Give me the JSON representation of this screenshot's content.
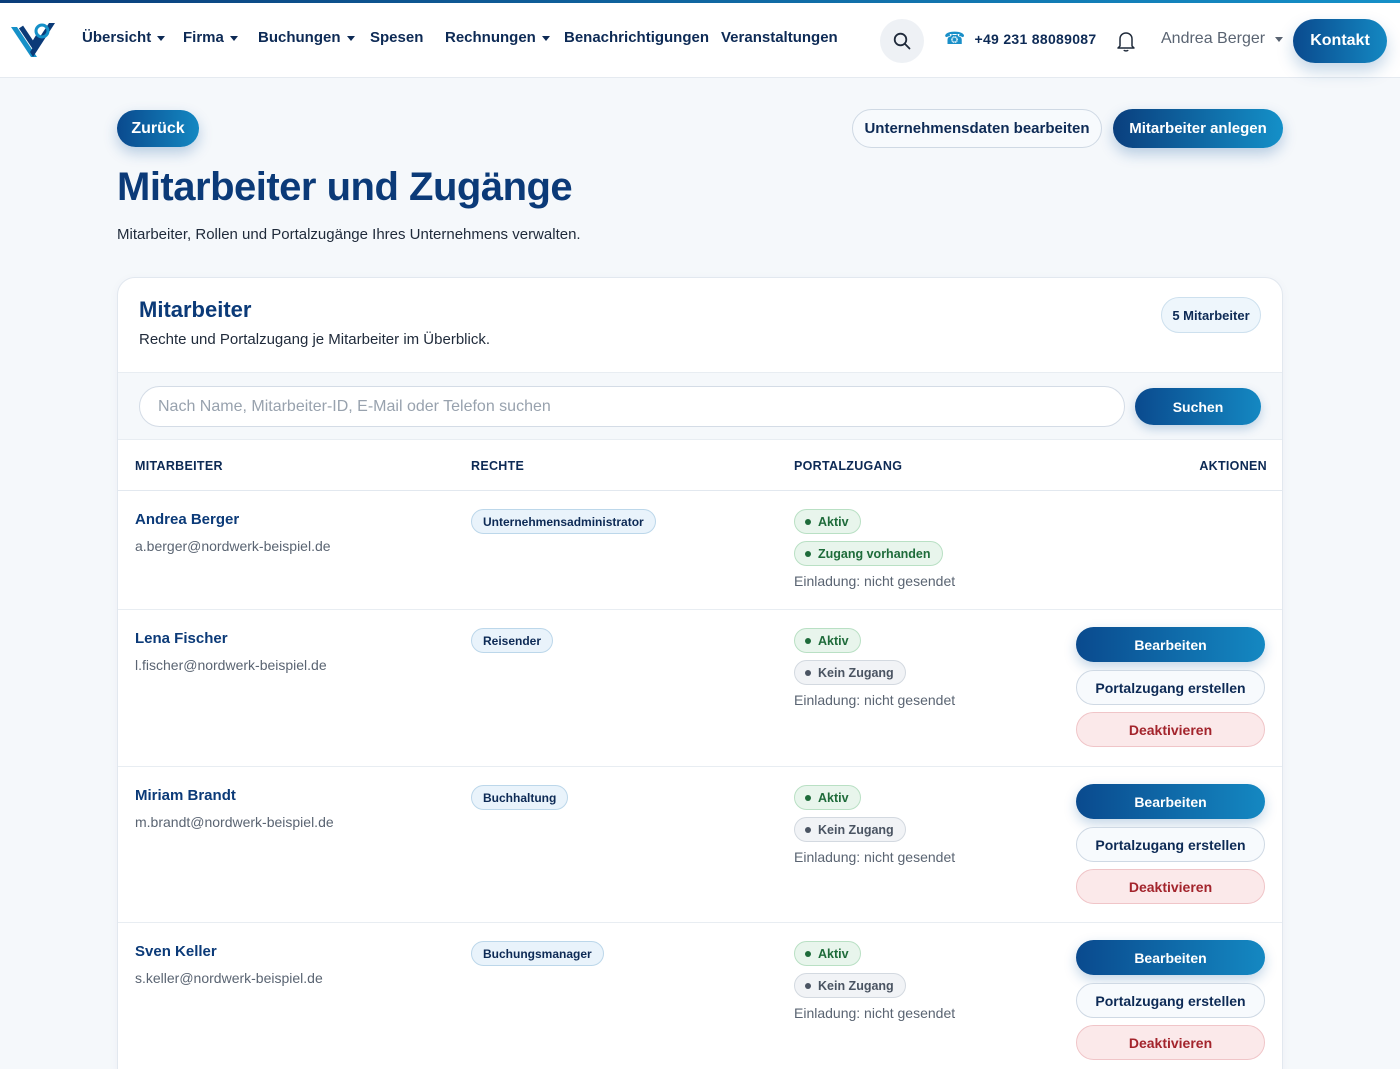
{
  "nav": {
    "items": [
      {
        "label": "Übersicht",
        "dropdown": true
      },
      {
        "label": "Firma",
        "dropdown": true
      },
      {
        "label": "Buchungen",
        "dropdown": true
      },
      {
        "label": "Spesen",
        "dropdown": false
      },
      {
        "label": "Rechnungen",
        "dropdown": true
      },
      {
        "label": "Benachrichtigungen",
        "dropdown": false
      },
      {
        "label": "Veranstaltungen",
        "dropdown": false
      }
    ],
    "phone": "+49 231 88089087",
    "user": "Andrea Berger",
    "contact_label": "Kontakt"
  },
  "page": {
    "back_label": "Zurück",
    "edit_company_label": "Unternehmensdaten bearbeiten",
    "add_employee_label": "Mitarbeiter anlegen",
    "title": "Mitarbeiter und Zugänge",
    "subtitle": "Mitarbeiter, Rollen und Portalzugänge Ihres Unternehmens verwalten."
  },
  "card": {
    "title": "Mitarbeiter",
    "subtitle": "Rechte und Portalzugang je Mitarbeiter im Überblick.",
    "count_badge": "5 Mitarbeiter",
    "search_placeholder": "Nach Name, Mitarbeiter-ID, E-Mail oder Telefon suchen",
    "search_value": "",
    "search_button": "Suchen"
  },
  "table": {
    "headers": [
      "MITARBEITER",
      "RECHTE",
      "PORTALZUGANG",
      "AKTIONEN"
    ],
    "rows": [
      {
        "name": "Andrea Berger",
        "email": "a.berger@nordwerk-beispiel.de",
        "role": "Unternehmensadministrator",
        "status": "Aktiv",
        "access": "Zugang vorhanden",
        "access_state": "yes",
        "invite": "Einladung: nicht gesendet",
        "actions": []
      },
      {
        "name": "Lena Fischer",
        "email": "l.fischer@nordwerk-beispiel.de",
        "role": "Reisender",
        "status": "Aktiv",
        "access": "Kein Zugang",
        "access_state": "no",
        "invite": "Einladung: nicht gesendet",
        "actions": [
          "Bearbeiten",
          "Portalzugang erstellen",
          "Deaktivieren"
        ]
      },
      {
        "name": "Miriam Brandt",
        "email": "m.brandt@nordwerk-beispiel.de",
        "role": "Buchhaltung",
        "status": "Aktiv",
        "access": "Kein Zugang",
        "access_state": "no",
        "invite": "Einladung: nicht gesendet",
        "actions": [
          "Bearbeiten",
          "Portalzugang erstellen",
          "Deaktivieren"
        ]
      },
      {
        "name": "Sven Keller",
        "email": "s.keller@nordwerk-beispiel.de",
        "role": "Buchungsmanager",
        "status": "Aktiv",
        "access": "Kein Zugang",
        "access_state": "no",
        "invite": "Einladung: nicht gesendet",
        "actions": [
          "Bearbeiten",
          "Portalzugang erstellen",
          "Deaktivieren"
        ]
      }
    ]
  },
  "colors": {
    "brand": "#0b3a78",
    "accent": "#1488c2",
    "success": "#1e6b3a",
    "danger": "#a3242c"
  }
}
